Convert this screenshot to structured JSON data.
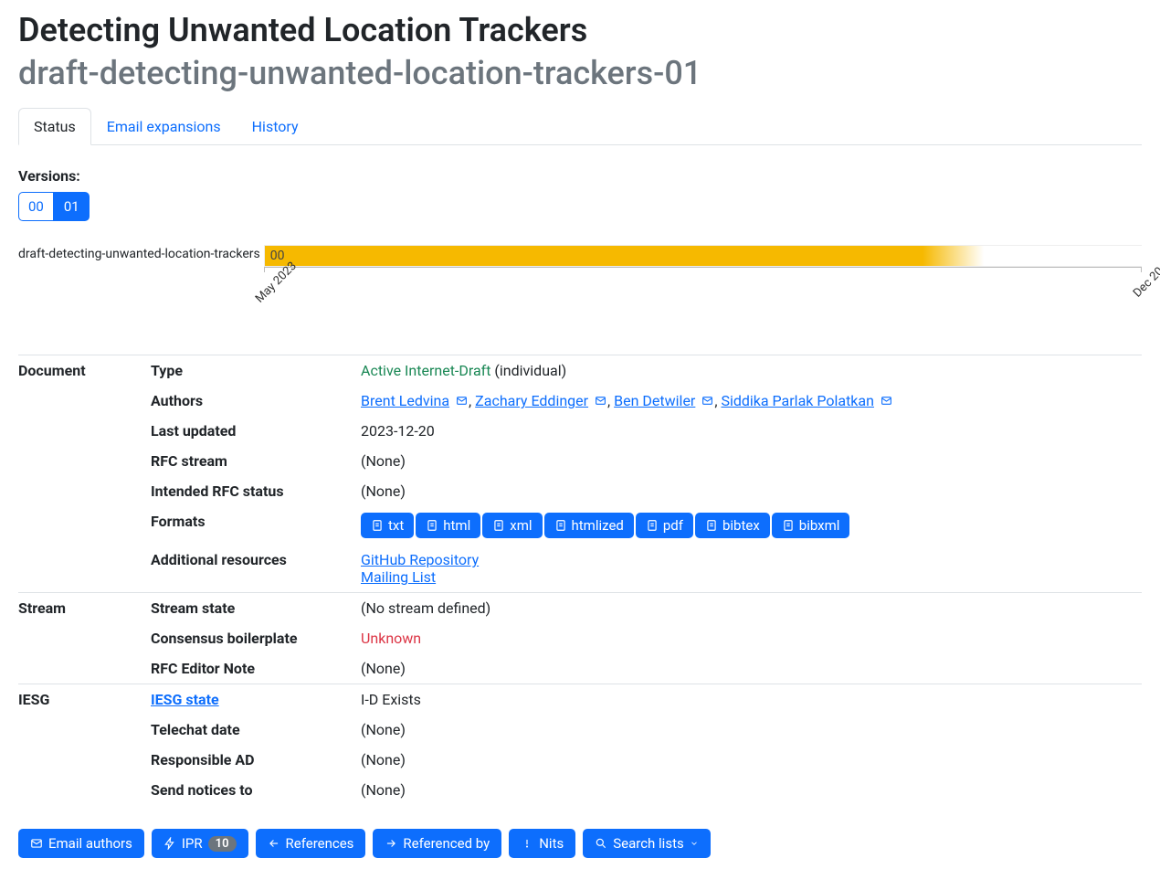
{
  "header": {
    "title": "Detecting Unwanted Location Trackers",
    "subtitle": "draft-detecting-unwanted-location-trackers-01"
  },
  "tabs": [
    {
      "label": "Status",
      "active": true
    },
    {
      "label": "Email expansions",
      "active": false
    },
    {
      "label": "History",
      "active": false
    }
  ],
  "versions": {
    "label": "Versions:",
    "items": [
      {
        "label": "00",
        "active": false
      },
      {
        "label": "01",
        "active": true
      }
    ]
  },
  "timeline": {
    "draft_name": "draft-detecting-unwanted-location-trackers",
    "bar_label": "00",
    "ticks": [
      {
        "label": "May 2023",
        "pos": 0
      },
      {
        "label": "Dec 20",
        "pos": 100
      }
    ]
  },
  "document": {
    "section": "Document",
    "rows": {
      "type_label": "Type",
      "type_status": "Active Internet-Draft",
      "type_suffix": " (individual)",
      "authors_label": "Authors",
      "authors": [
        {
          "name": "Brent Ledvina"
        },
        {
          "name": "Zachary Eddinger"
        },
        {
          "name": "Ben Detwiler"
        },
        {
          "name": "Siddika Parlak Polatkan"
        }
      ],
      "last_updated_label": "Last updated",
      "last_updated": "2023-12-20",
      "rfc_stream_label": "RFC stream",
      "rfc_stream": "(None)",
      "intended_label": "Intended RFC status",
      "intended": "(None)",
      "formats_label": "Formats",
      "formats": [
        "txt",
        "html",
        "xml",
        "htmlized",
        "pdf",
        "bibtex",
        "bibxml"
      ],
      "additional_label": "Additional resources",
      "additional": [
        "GitHub Repository",
        "Mailing List"
      ]
    }
  },
  "stream": {
    "section": "Stream",
    "rows": {
      "state_label": "Stream state",
      "state": "(No stream defined)",
      "consensus_label": "Consensus boilerplate",
      "consensus": "Unknown",
      "editor_note_label": "RFC Editor Note",
      "editor_note": "(None)"
    }
  },
  "iesg": {
    "section": "IESG",
    "rows": {
      "state_label": "IESG state",
      "state": "I-D Exists",
      "telechat_label": "Telechat date",
      "telechat": "(None)",
      "ad_label": "Responsible AD",
      "ad": "(None)",
      "notices_label": "Send notices to",
      "notices": "(None)"
    }
  },
  "actions": {
    "email_authors": "Email authors",
    "ipr": "IPR",
    "ipr_count": "10",
    "references": "References",
    "referenced_by": "Referenced by",
    "nits": "Nits",
    "search_lists": "Search lists"
  }
}
